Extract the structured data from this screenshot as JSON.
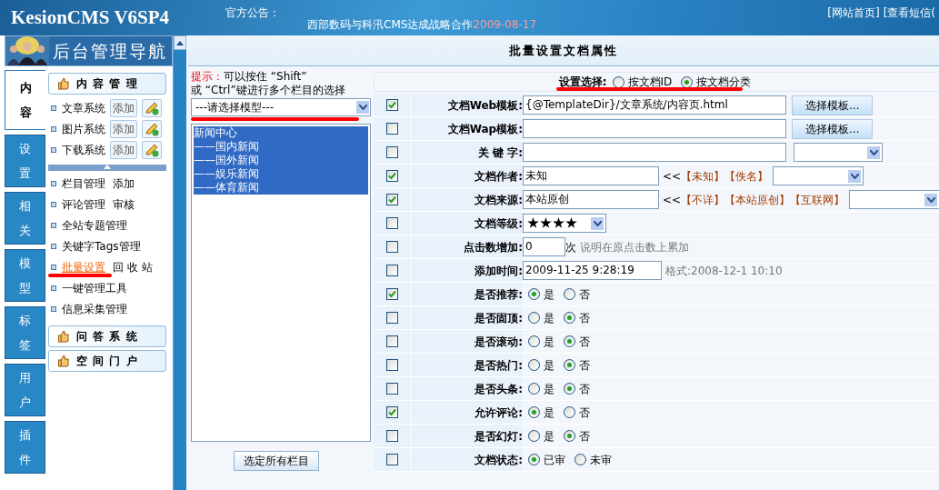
{
  "header": {
    "logo": "KesionCMS V6SP4",
    "notice_label": "官方公告：",
    "notice_text": "西部数码与科汛CMS达成战略合作",
    "notice_date": "2009-08-17",
    "links": [
      "[网站首页]",
      "[查看短信("
    ]
  },
  "nav": {
    "title": "后台管理导航",
    "tabs": [
      {
        "label": "内容",
        "selected": true
      },
      {
        "label": "设置",
        "selected": false
      },
      {
        "label": "相关",
        "selected": false
      },
      {
        "label": "模型",
        "selected": false
      },
      {
        "label": "标签",
        "selected": false
      },
      {
        "label": "用户",
        "selected": false
      },
      {
        "label": "插件",
        "selected": false
      }
    ],
    "section": "内 容 管 理",
    "systems": [
      {
        "label": "文章系统",
        "add": "添加"
      },
      {
        "label": "图片系统",
        "add": "添加"
      },
      {
        "label": "下载系统",
        "add": "添加"
      }
    ],
    "items": [
      {
        "label": "栏目管理",
        "extra": "添加",
        "selected": false
      },
      {
        "label": "评论管理",
        "extra": "审核",
        "selected": false
      },
      {
        "label": "全站专题管理",
        "selected": false
      },
      {
        "label": "关键字Tags管理",
        "selected": false
      },
      {
        "label": "批量设置",
        "extra": "回 收 站",
        "selected": true
      },
      {
        "label": "一键管理工具",
        "selected": false
      },
      {
        "label": "信息采集管理",
        "selected": false
      }
    ],
    "other_sections": [
      "问 答 系 统",
      "空 间 门 户"
    ]
  },
  "main": {
    "title": "批量设置文档属性",
    "hint_label": "提示：",
    "hint_line1": "可以按住 “Shift”",
    "hint_line2": "或 “Ctrl”键进行多个栏目的选择",
    "model_select": "---请选择模型---",
    "categories": [
      {
        "label": "新闻中心",
        "selected": true,
        "children": [
          {
            "label": "——国内新闻",
            "selected": true
          },
          {
            "label": "——国外新闻",
            "selected": true
          },
          {
            "label": "——娱乐新闻",
            "selected": true
          },
          {
            "label": "——体育新闻",
            "selected": true
          }
        ]
      }
    ],
    "select_all_button": "选定所有栏目",
    "setting_choice": {
      "label": "设置选择:",
      "options": [
        {
          "label": "按文档ID",
          "selected": false
        },
        {
          "label": "按文档分类",
          "selected": true
        }
      ]
    },
    "rows": [
      {
        "kind": "template",
        "checked": true,
        "label": "文档Web模板:",
        "value": "{@TemplateDir}/文章系统/内容页.html",
        "button": "选择模板..."
      },
      {
        "kind": "template",
        "checked": false,
        "label": "文档Wap模板:",
        "button": "选择模板..."
      },
      {
        "kind": "keyword",
        "checked": false,
        "label": "关 键 字:"
      },
      {
        "kind": "quick",
        "checked": true,
        "label": "文档作者:",
        "value": "未知",
        "prefix": "<<",
        "quick": [
          "【未知】",
          "【佚名】"
        ]
      },
      {
        "kind": "quick",
        "checked": true,
        "label": "文档来源:",
        "value": "本站原创",
        "prefix": "<<",
        "quick": [
          "【不详】",
          "【本站原创】",
          "【互联网】"
        ]
      },
      {
        "kind": "stars",
        "checked": false,
        "label": "文档等级:",
        "stars": 4
      },
      {
        "kind": "number",
        "checked": false,
        "label": "点击数增加:",
        "value": "0",
        "suffix": "次",
        "note": "说明在原点击数上累加"
      },
      {
        "kind": "datetime",
        "checked": false,
        "label": "添加时间:",
        "value": "2009-11-25 9:28:19",
        "note": "格式:2008-12-1 10:10"
      },
      {
        "kind": "radio",
        "checked": true,
        "label": "是否推荐:",
        "options": [
          {
            "label": "是",
            "selected": true
          },
          {
            "label": "否",
            "selected": false
          }
        ]
      },
      {
        "kind": "radio",
        "checked": false,
        "label": "是否固顶:",
        "options": [
          {
            "label": "是",
            "selected": false
          },
          {
            "label": "否",
            "selected": true
          }
        ]
      },
      {
        "kind": "radio",
        "checked": false,
        "label": "是否滚动:",
        "options": [
          {
            "label": "是",
            "selected": false
          },
          {
            "label": "否",
            "selected": true
          }
        ]
      },
      {
        "kind": "radio",
        "checked": false,
        "label": "是否热门:",
        "options": [
          {
            "label": "是",
            "selected": false
          },
          {
            "label": "否",
            "selected": true
          }
        ]
      },
      {
        "kind": "radio",
        "checked": false,
        "label": "是否头条:",
        "options": [
          {
            "label": "是",
            "selected": false
          },
          {
            "label": "否",
            "selected": true
          }
        ]
      },
      {
        "kind": "radio",
        "checked": true,
        "label": "允许评论:",
        "options": [
          {
            "label": "是",
            "selected": true
          },
          {
            "label": "否",
            "selected": false
          }
        ]
      },
      {
        "kind": "radio",
        "checked": false,
        "label": "是否幻灯:",
        "options": [
          {
            "label": "是",
            "selected": false
          },
          {
            "label": "否",
            "selected": true
          }
        ]
      },
      {
        "kind": "radio",
        "checked": false,
        "label": "文档状态:",
        "options": [
          {
            "label": "已审",
            "selected": true
          },
          {
            "label": "未审",
            "selected": false
          }
        ]
      }
    ]
  }
}
